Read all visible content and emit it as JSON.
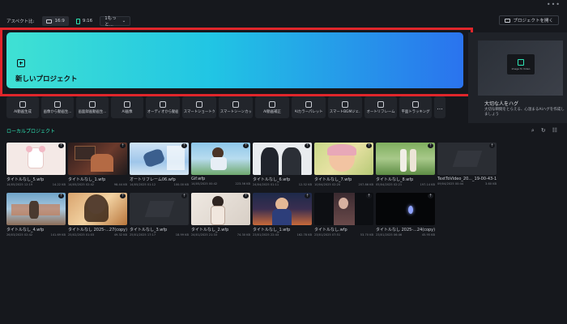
{
  "topbar": {
    "more_icon": "ellipsis-icon"
  },
  "aspect": {
    "label": "アスペクト比:",
    "options": [
      {
        "label": "16:9",
        "icon": "landscape-icon"
      },
      {
        "label": "9:16",
        "icon": "portrait-icon"
      }
    ],
    "select_value": "1もっと..."
  },
  "open_project": {
    "label": "プロジェクトを開く",
    "icon": "folder-icon"
  },
  "new_project": {
    "label": "新しいプロジェクト",
    "icon": "plus-square-icon"
  },
  "promo": {
    "thumb_caption": "Image To Video",
    "title": "大切な人をハグ",
    "description": "大切な瞬間をとらえる、心温まるAIハグを作成しましょう"
  },
  "tools": [
    {
      "label": "AI動画生成"
    },
    {
      "label": "画像から動画生..."
    },
    {
      "label": "画面録画動画生..."
    },
    {
      "label": "AI画像"
    },
    {
      "label": "オーディオから動画"
    },
    {
      "label": "スマートショートク..."
    },
    {
      "label": "スマートシーンカット"
    },
    {
      "label": "AI動画補正"
    },
    {
      "label": "AIカラーパレット"
    },
    {
      "label": "スマートBGMジェ..."
    },
    {
      "label": "オートリフレーム"
    },
    {
      "label": "平面トラッキング"
    },
    {
      "label": "..."
    }
  ],
  "local_projects": {
    "title": "ローカルプロジェクト"
  },
  "projects": [
    {
      "name": "タイトルなし_5.wfp",
      "date": "14/05/2025 12:19",
      "size": "14.22 KB"
    },
    {
      "name": "タイトルなし_1.wfp",
      "date": "14/05/2025 02:42",
      "size": "98.44 KB"
    },
    {
      "name": "オートリフレーム06.wfp",
      "date": "14/05/2025 01:12",
      "size": "100.00 KB"
    },
    {
      "name": "Gif.wfp",
      "date": "14/05/2025 00:42",
      "size": "223.56 KB"
    },
    {
      "name": "タイトルなし_6.wfp",
      "date": "24/04/2025 01:11",
      "size": "12.52 KB"
    },
    {
      "name": "タイトルなし_7.wfp",
      "date": "10/04/2025 02:20",
      "size": "207.86 KB"
    },
    {
      "name": "タイトルなし_8.wfp",
      "date": "05/04/2025 02:21",
      "size": "197.14 KB"
    },
    {
      "name": "TextToVideo_20..._19-00-43-16.wfp",
      "date": "09/04/2025 00:44",
      "size": "3.60 KB"
    },
    {
      "name": "タイトルなし_4.wfp",
      "date": "26/03/2025 02:42",
      "size": "141.69 KB"
    },
    {
      "name": "タイトルなし 2025-...27(copy).wfp",
      "date": "25/02/2025 01:03",
      "size": "49.32 KB"
    },
    {
      "name": "タイトルなし_3.wfp",
      "date": "25/01/2025 17:17",
      "size": "18.99 KB"
    },
    {
      "name": "タイトルなし_2.wfp",
      "date": "24/01/2025 21:33",
      "size": "74.30 KB"
    },
    {
      "name": "タイトルなし_1.wfp",
      "date": "23/01/2025 22:43",
      "size": "162.78 KB"
    },
    {
      "name": "タイトルなし.wfp",
      "date": "23/01/2025 07:51",
      "size": "53.70 KB"
    },
    {
      "name": "タイトルなし 2025-...24(copy).wfp",
      "date": "23/01/2025 06:46",
      "size": "45.95 KB"
    }
  ]
}
